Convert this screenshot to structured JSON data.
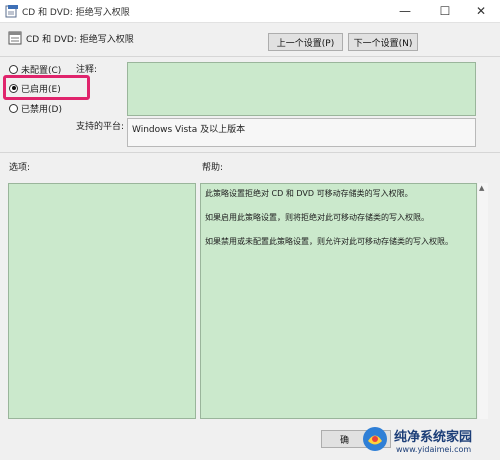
{
  "window": {
    "title": "CD 和 DVD: 拒绝写入权限",
    "minimize_glyph": "—",
    "maximize_glyph": "☐",
    "close_glyph": "✕"
  },
  "header": {
    "policy_name": "CD 和 DVD: 拒绝写入权限",
    "prev_setting_label": "上一个设置(P)",
    "next_setting_label": "下一个设置(N)"
  },
  "state_options": [
    {
      "label": "未配置(C)",
      "selected": false
    },
    {
      "label": "已启用(E)",
      "selected": true
    },
    {
      "label": "已禁用(D)",
      "selected": false
    }
  ],
  "comment": {
    "label": "注释:",
    "value": ""
  },
  "supported_on": {
    "label": "支持的平台:",
    "value": "Windows Vista 及以上版本"
  },
  "options_label": "选项:",
  "help": {
    "label": "帮助:",
    "lines": [
      "此策略设置拒绝对 CD 和 DVD 可移动存储类的写入权限。",
      "如果启用此策略设置，则将拒绝对此可移动存储类的写入权限。",
      "如果禁用或未配置此策略设置，则允许对此可移动存储类的写入权限。"
    ]
  },
  "ok_button_partial": "确",
  "watermark": {
    "text": "纯净系统家园",
    "url": "www.yidaimei.com"
  },
  "colors": {
    "highlight": "#e0246c",
    "field_green": "#cbe9cc"
  }
}
